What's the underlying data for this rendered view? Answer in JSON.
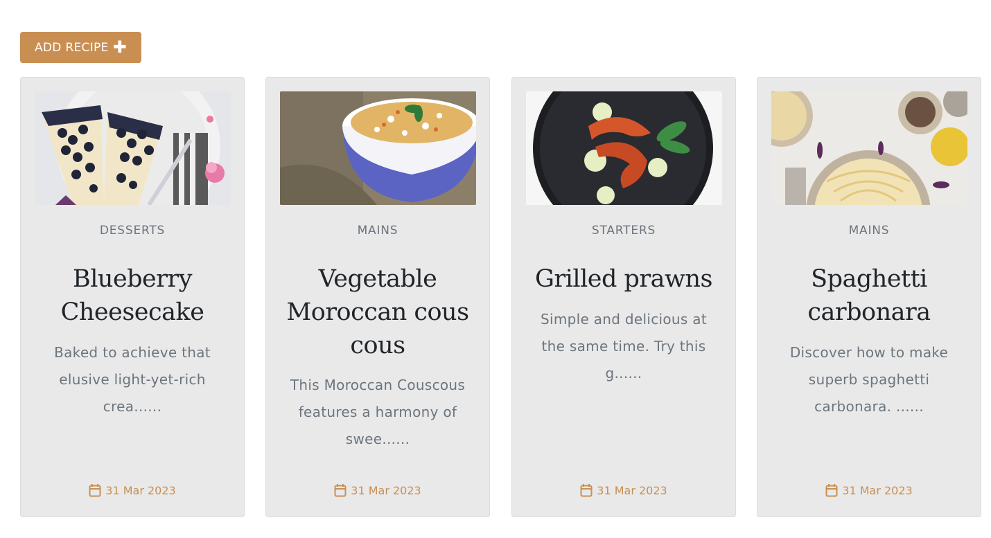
{
  "toolbar": {
    "add_recipe_label": "ADD RECIPE",
    "add_icon": "plus-icon"
  },
  "recipes": [
    {
      "category": "DESSERTS",
      "title": "Blueberry Cheesecake",
      "description": "Baked to achieve that elusive light-yet-rich crea......",
      "date": "31 Mar 2023",
      "image": "blueberry-cheesecake-photo"
    },
    {
      "category": "MAINS",
      "title": "Vegetable Moroccan cous cous",
      "description": "This Moroccan Couscous features a harmony of swee......",
      "date": "31 Mar 2023",
      "image": "couscous-bowl-photo"
    },
    {
      "category": "STARTERS",
      "title": "Grilled prawns",
      "description": "Simple and delicious at the same time. Try this g......",
      "date": "31 Mar 2023",
      "image": "grilled-prawns-photo"
    },
    {
      "category": "MAINS",
      "title": "Spaghetti carbonara",
      "description": "Discover how to make superb spaghetti carbonara. ......",
      "date": "31 Mar 2023",
      "image": "spaghetti-carbonara-photo"
    }
  ],
  "colors": {
    "accent": "#c98f52",
    "card_bg": "#e9e9e9",
    "muted_text": "#6c757d",
    "title_text": "#212529"
  }
}
